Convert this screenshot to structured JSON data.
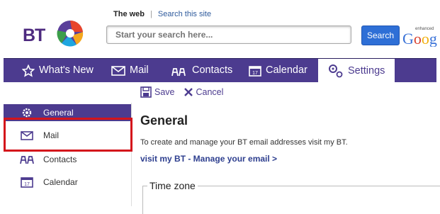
{
  "header": {
    "logo_text": "BT",
    "search_tabs": [
      "The web",
      "Search this site"
    ],
    "search_placeholder": "Start your search here...",
    "search_button": "Search",
    "google_logo_text": "Goog",
    "google_enhanced_label": "enhanced"
  },
  "nav": {
    "items": [
      {
        "label": "What's New",
        "icon": "star-icon"
      },
      {
        "label": "Mail",
        "icon": "envelope-icon"
      },
      {
        "label": "Contacts",
        "icon": "contacts-icon"
      },
      {
        "label": "Calendar",
        "icon": "calendar-icon"
      },
      {
        "label": "Settings",
        "icon": "settings-icon"
      }
    ],
    "active": "Settings"
  },
  "toolbar": {
    "save_label": "Save",
    "cancel_label": "Cancel"
  },
  "sidebar": {
    "items": [
      {
        "label": "General",
        "icon": "gear-icon"
      },
      {
        "label": "Mail",
        "icon": "envelope-icon"
      },
      {
        "label": "Contacts",
        "icon": "contacts-icon"
      },
      {
        "label": "Calendar",
        "icon": "calendar-icon"
      }
    ],
    "selected": "General"
  },
  "main": {
    "title": "General",
    "description": "To create and manage your BT email addresses visit my BT.",
    "link": "visit my BT - Manage your email >",
    "section_timezone": "Time zone"
  },
  "calendar_icon_day": "17",
  "colors": {
    "brand_purple": "#4c3b8f",
    "search_blue": "#2e6fd6",
    "highlight_red": "#d4141b"
  }
}
